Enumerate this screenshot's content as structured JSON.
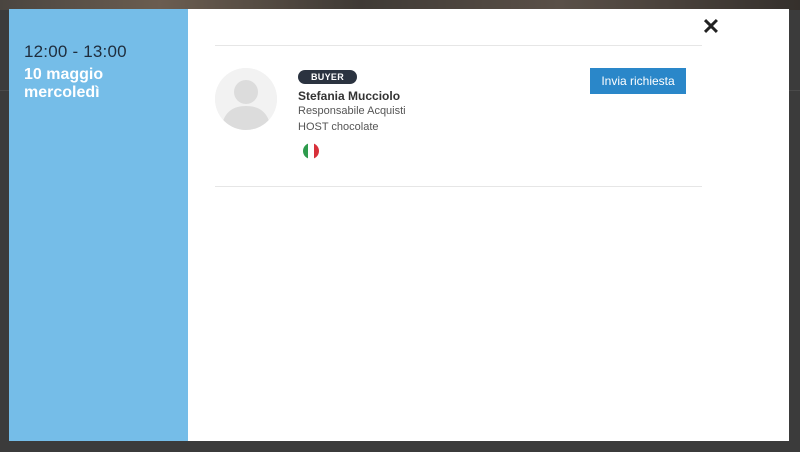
{
  "slot": {
    "time": "12:00 - 13:00",
    "date_line1": "10 maggio",
    "date_line2": "mercoledì"
  },
  "close_symbol": "✕",
  "contact": {
    "badge": "BUYER",
    "name": "Stefania Mucciolo",
    "role": "Responsabile Acquisti",
    "company": "HOST chocolate",
    "country_flag": "italy-flag-icon",
    "action_label": "Invia richiesta"
  },
  "colors": {
    "sidebar": "#75bde8",
    "button": "#2a87c9",
    "badge": "#2b3340"
  }
}
